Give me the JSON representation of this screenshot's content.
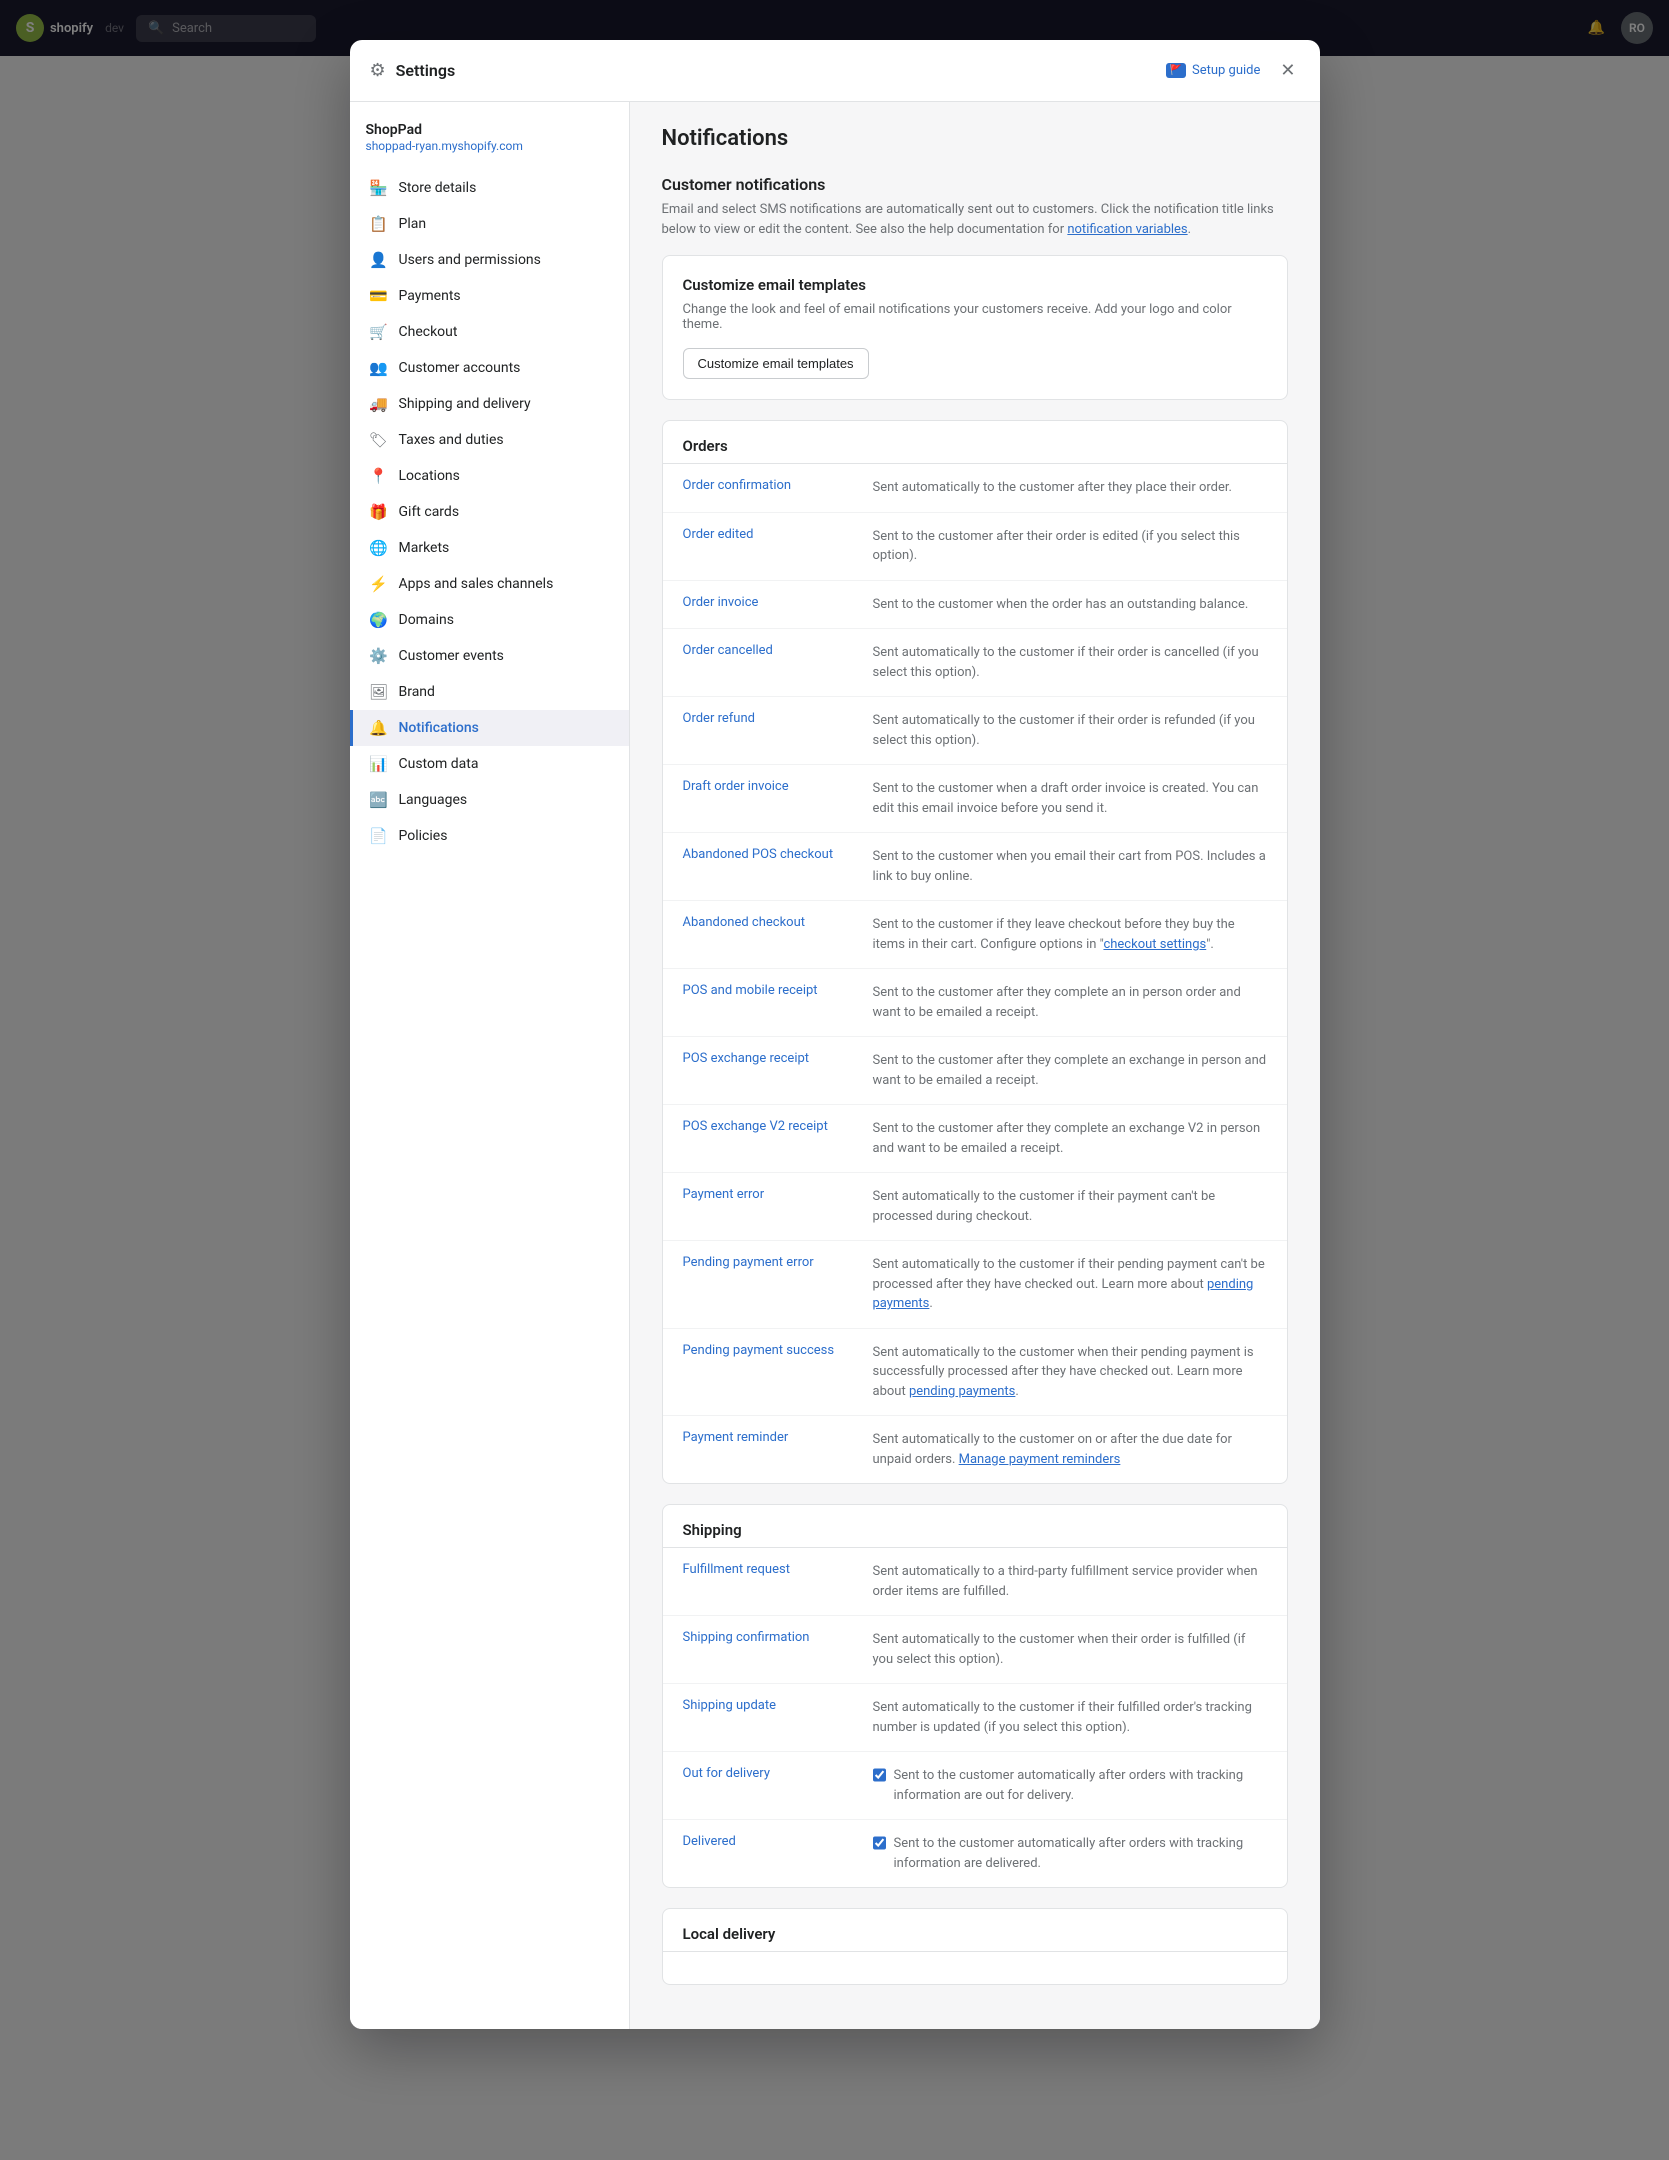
{
  "app": {
    "logo_text": "shopify",
    "store_name": "dev",
    "search_placeholder": "Search",
    "notification_icon": "🔔",
    "avatar_initials": "RO"
  },
  "modal": {
    "title": "Settings",
    "setup_guide_label": "Setup guide",
    "close_label": "✕"
  },
  "sidebar": {
    "store_name": "ShopPad",
    "store_url": "shoppad-ryan.myshopify.com",
    "items": [
      {
        "id": "store-details",
        "label": "Store details",
        "icon": "🏪"
      },
      {
        "id": "plan",
        "label": "Plan",
        "icon": "📋"
      },
      {
        "id": "users-permissions",
        "label": "Users and permissions",
        "icon": "👤"
      },
      {
        "id": "payments",
        "label": "Payments",
        "icon": "💳"
      },
      {
        "id": "checkout",
        "label": "Checkout",
        "icon": "🛒"
      },
      {
        "id": "customer-accounts",
        "label": "Customer accounts",
        "icon": "👥"
      },
      {
        "id": "shipping-delivery",
        "label": "Shipping and delivery",
        "icon": "🚚"
      },
      {
        "id": "taxes-duties",
        "label": "Taxes and duties",
        "icon": "🏷"
      },
      {
        "id": "locations",
        "label": "Locations",
        "icon": "📍"
      },
      {
        "id": "gift-cards",
        "label": "Gift cards",
        "icon": "🎁"
      },
      {
        "id": "markets",
        "label": "Markets",
        "icon": "🌐"
      },
      {
        "id": "apps-sales-channels",
        "label": "Apps and sales channels",
        "icon": "⚡"
      },
      {
        "id": "domains",
        "label": "Domains",
        "icon": "🌍"
      },
      {
        "id": "customer-events",
        "label": "Customer events",
        "icon": "⚙️"
      },
      {
        "id": "brand",
        "label": "Brand",
        "icon": "🖼"
      },
      {
        "id": "notifications",
        "label": "Notifications",
        "icon": "🔔",
        "active": true
      },
      {
        "id": "custom-data",
        "label": "Custom data",
        "icon": "📊"
      },
      {
        "id": "languages",
        "label": "Languages",
        "icon": "🔤"
      },
      {
        "id": "policies",
        "label": "Policies",
        "icon": "📄"
      }
    ]
  },
  "page": {
    "title": "Notifications",
    "customer_notifications": {
      "heading": "Customer notifications",
      "description": "Email and select SMS notifications are automatically sent out to customers. Click the notification title links below to view or edit the content. See also the help documentation for",
      "link_text": "notification variables",
      "link_href": "#"
    },
    "customize_card": {
      "title": "Customize email templates",
      "description": "Change the look and feel of email notifications your customers receive. Add your logo and color theme.",
      "button_label": "Customize email templates"
    },
    "orders_section": {
      "heading": "Orders",
      "items": [
        {
          "link": "Order confirmation",
          "desc": "Sent automatically to the customer after they place their order."
        },
        {
          "link": "Order edited",
          "desc": "Sent to the customer after their order is edited (if you select this option)."
        },
        {
          "link": "Order invoice",
          "desc": "Sent to the customer when the order has an outstanding balance."
        },
        {
          "link": "Order cancelled",
          "desc": "Sent automatically to the customer if their order is cancelled (if you select this option)."
        },
        {
          "link": "Order refund",
          "desc": "Sent automatically to the customer if their order is refunded (if you select this option)."
        },
        {
          "link": "Draft order invoice",
          "desc": "Sent to the customer when a draft order invoice is created. You can edit this email invoice before you send it."
        },
        {
          "link": "Abandoned POS checkout",
          "desc": "Sent to the customer when you email their cart from POS. Includes a link to buy online."
        },
        {
          "link": "Abandoned checkout",
          "desc": "Sent to the customer if they leave checkout before they buy the items in their cart. Configure options in \"checkout settings\"."
        },
        {
          "link": "POS and mobile receipt",
          "desc": "Sent to the customer after they complete an in person order and want to be emailed a receipt."
        },
        {
          "link": "POS exchange receipt",
          "desc": "Sent to the customer after they complete an exchange in person and want to be emailed a receipt."
        },
        {
          "link": "POS exchange V2 receipt",
          "desc": "Sent to the customer after they complete an exchange V2 in person and want to be emailed a receipt."
        },
        {
          "link": "Payment error",
          "desc": "Sent automatically to the customer if their payment can't be processed during checkout."
        },
        {
          "link": "Pending payment error",
          "desc": "Sent automatically to the customer if their pending payment can't be processed after they have checked out. Learn more about",
          "inline_link": "pending payments",
          "desc_suffix": "."
        },
        {
          "link": "Pending payment success",
          "desc": "Sent automatically to the customer when their pending payment is successfully processed after they have checked out. Learn more about",
          "inline_link": "pending payments",
          "desc_suffix": "."
        },
        {
          "link": "Payment reminder",
          "desc": "Sent automatically to the customer on or after the due date for unpaid orders.",
          "inline_link": "Manage payment reminders",
          "desc_suffix": ""
        }
      ]
    },
    "shipping_section": {
      "heading": "Shipping",
      "items": [
        {
          "link": "Fulfillment request",
          "desc": "Sent automatically to a third-party fulfillment service provider when order items are fulfilled."
        },
        {
          "link": "Shipping confirmation",
          "desc": "Sent automatically to the customer when their order is fulfilled (if you select this option)."
        },
        {
          "link": "Shipping update",
          "desc": "Sent automatically to the customer if their fulfilled order's tracking number is updated (if you select this option)."
        },
        {
          "link": "Out for delivery",
          "desc": "Sent to the customer automatically after orders with tracking information are out for delivery.",
          "has_checkbox": true,
          "checked": true
        },
        {
          "link": "Delivered",
          "desc": "Sent to the customer automatically after orders with tracking information are delivered.",
          "has_checkbox": true,
          "checked": true
        }
      ]
    },
    "local_delivery_section": {
      "heading": "Local delivery"
    }
  }
}
